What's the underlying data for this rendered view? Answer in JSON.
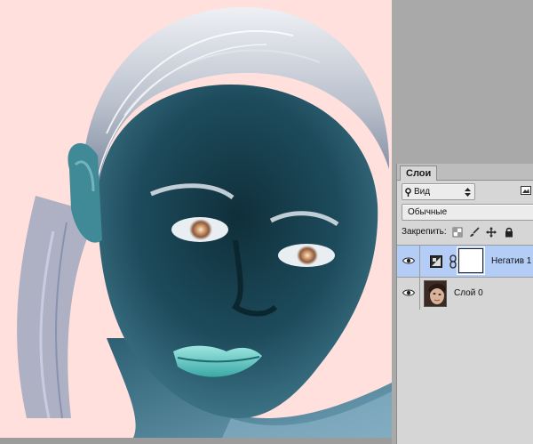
{
  "canvas": {
    "image": "inverted-portrait-photo",
    "background_color": "#ffe0dc"
  },
  "layers_panel": {
    "tab_label": "Слои",
    "filter": {
      "glyph": "Ρ",
      "label": "Вид",
      "arrow": "⬍"
    },
    "filter_icon": "image-filter-icon",
    "blend_mode": {
      "label": "Обычные"
    },
    "lock": {
      "label": "Закрепить:",
      "icons": [
        "lock-transparent-icon",
        "lock-brush-icon",
        "lock-move-icon",
        "lock-all-icon"
      ]
    },
    "layers": [
      {
        "name": "Негатив 1",
        "type": "adjustment",
        "visible": true,
        "selected": true,
        "icon": "invert-adjustment-icon",
        "mask": "white-mask"
      },
      {
        "name": "Слой 0",
        "type": "pixel",
        "visible": true,
        "selected": false,
        "thumbnail": "portrait-thumbnail"
      }
    ],
    "selected_color": "#b4cdf7"
  }
}
